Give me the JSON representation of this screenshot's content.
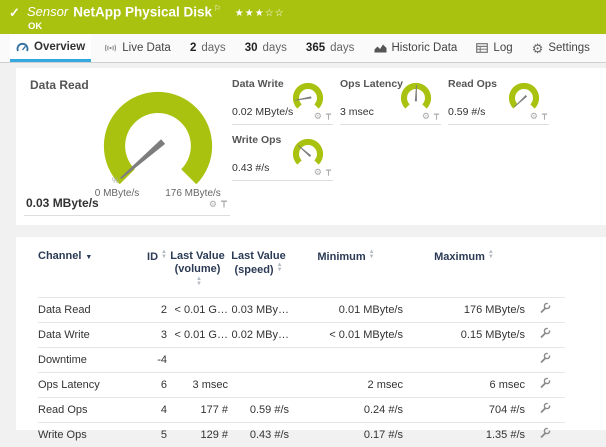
{
  "colors": {
    "accent_green": "#a9c20f",
    "active_tab_blue": "#35a8e0",
    "header_navy": "#2b3a55"
  },
  "icons": {
    "check": "✓",
    "flag": "⚐",
    "gear": "⚙",
    "percent": "%",
    "sort_up": "▲",
    "sort_down": "▼",
    "channel_sort": "▼"
  },
  "header": {
    "kind": "Sensor",
    "title": "NetApp Physical Disk",
    "status": "OK",
    "stars_filled": "★★★",
    "stars_empty": "☆☆"
  },
  "tabs": [
    {
      "label": "Overview"
    },
    {
      "label": "Live Data"
    },
    {
      "num": "2",
      "label": "days"
    },
    {
      "num": "30",
      "label": "days"
    },
    {
      "num": "365",
      "label": "days"
    },
    {
      "label": "Historic Data"
    },
    {
      "label": "Log"
    },
    {
      "label": "Settings"
    }
  ],
  "gauges": {
    "main": {
      "label": "Data Read",
      "value": "0.03 MByte/s",
      "scale_min": "0 MByte/s",
      "scale_max": "176 MByte/s",
      "needle_deg": -131
    },
    "small": [
      {
        "label": "Data Write",
        "value": "0.02 MByte/s",
        "needle_deg": -100
      },
      {
        "label": "Ops Latency",
        "value": "3 msec",
        "needle_deg": 2
      },
      {
        "label": "Read Ops",
        "value": "0.59 #/s",
        "needle_deg": -133
      },
      {
        "label": "Write Ops",
        "value": "0.43 #/s",
        "needle_deg": -49
      }
    ]
  },
  "table": {
    "columns": {
      "channel": "Channel",
      "id": "ID",
      "last_value_volume_line1": "Last Value",
      "last_value_volume_line2": "(volume)",
      "last_value_speed_line1": "Last Value",
      "last_value_speed_line2": "(speed)",
      "minimum": "Minimum",
      "maximum": "Maximum"
    },
    "rows": [
      {
        "channel": "Data Read",
        "id": "2",
        "vol": "< 0.01 G…",
        "speed": "0.03 MBy…",
        "min": "0.01 MByte/s",
        "max": "176 MByte/s"
      },
      {
        "channel": "Data Write",
        "id": "3",
        "vol": "< 0.01 G…",
        "speed": "0.02 MBy…",
        "min": "< 0.01 MByte/s",
        "max": "0.15 MByte/s"
      },
      {
        "channel": "Downtime",
        "id": "-4",
        "vol": "",
        "speed": "",
        "min": "",
        "max": ""
      },
      {
        "channel": "Ops Latency",
        "id": "6",
        "vol": "3 msec",
        "speed": "",
        "min": "2 msec",
        "max": "6 msec"
      },
      {
        "channel": "Read Ops",
        "id": "4",
        "vol": "177 #",
        "speed": "0.59 #/s",
        "min": "0.24 #/s",
        "max": "704 #/s"
      },
      {
        "channel": "Write Ops",
        "id": "5",
        "vol": "129 #",
        "speed": "0.43 #/s",
        "min": "0.17 #/s",
        "max": "1.35 #/s"
      }
    ]
  }
}
